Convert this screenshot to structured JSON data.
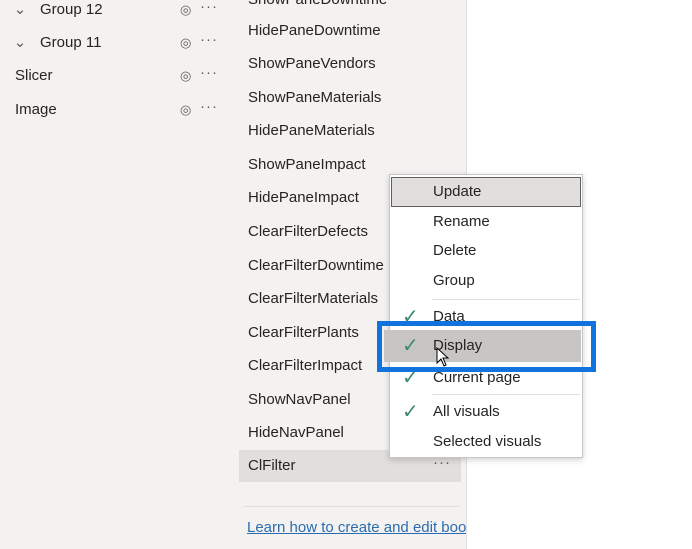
{
  "selection_pane": {
    "items": [
      {
        "label": "Group 12",
        "expandable": true
      },
      {
        "label": "Group 11",
        "expandable": true
      },
      {
        "label": "Slicer",
        "expandable": false
      },
      {
        "label": "Image",
        "expandable": false
      }
    ],
    "icons": {
      "visibility": "eye-icon",
      "more": "more-options-icon"
    }
  },
  "bookmarks_pane": {
    "items": [
      {
        "label": "ShowPaneDowntime"
      },
      {
        "label": "HidePaneDowntime"
      },
      {
        "label": "ShowPaneVendors"
      },
      {
        "label": "ShowPaneMaterials"
      },
      {
        "label": "HidePaneMaterials"
      },
      {
        "label": "ShowPaneImpact"
      },
      {
        "label": "HidePaneImpact"
      },
      {
        "label": "ClearFilterDefects"
      },
      {
        "label": "ClearFilterDowntime"
      },
      {
        "label": "ClearFilterMaterials"
      },
      {
        "label": "ClearFilterPlants"
      },
      {
        "label": "ClearFilterImpact"
      },
      {
        "label": "ShowNavPanel"
      },
      {
        "label": "HideNavPanel"
      },
      {
        "label": "ClFilter",
        "selected": true
      }
    ],
    "learn_link": "Learn how to create and edit bookmarks"
  },
  "context_menu": {
    "items": [
      {
        "label": "Update",
        "hover": true
      },
      {
        "label": "Rename"
      },
      {
        "label": "Delete"
      },
      {
        "label": "Group"
      },
      {
        "label": "Data",
        "checked": true
      },
      {
        "label": "Display",
        "checked": true,
        "highlighted": true
      },
      {
        "label": "Current page",
        "checked": true
      },
      {
        "label": "All visuals",
        "checked": true
      },
      {
        "label": "Selected visuals",
        "checked": false
      }
    ]
  },
  "colors": {
    "pane_bg": "#f3f2f1",
    "highlight": "#1273de",
    "check": "#3a8b6b",
    "link": "#2b6cb0"
  }
}
